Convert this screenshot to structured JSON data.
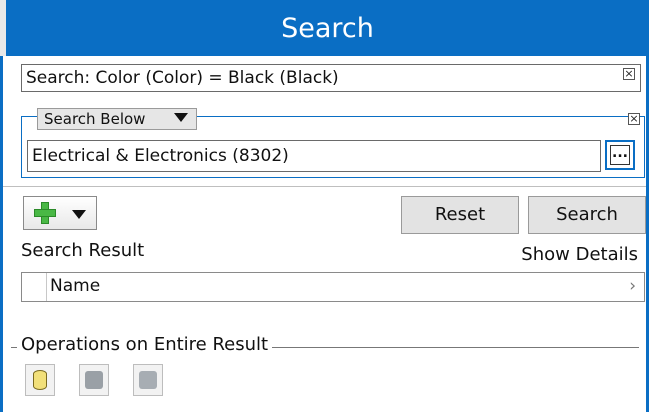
{
  "header": {
    "title": "Search"
  },
  "criteria": {
    "text": "Search: Color (Color) = Black (Black)",
    "close_glyph": "×"
  },
  "scope": {
    "dropdown_label": "Search Below",
    "close_glyph": "×",
    "value": "Electrical & Electronics (8302)",
    "browse_glyph": "..."
  },
  "toolbar": {
    "add_icon": "plus-icon",
    "reset_label": "Reset",
    "search_label": "Search"
  },
  "results": {
    "title": "Search Result",
    "details_link": "Show Details",
    "columns": [
      "Name"
    ],
    "column_arrow": "›"
  },
  "operations": {
    "title": "Operations on Entire Result",
    "icons": [
      "database-icon",
      "grey-db-icon",
      "grey-sheet-icon"
    ]
  },
  "colors": {
    "accent": "#0a6ec4",
    "button_bg": "#e3e3e3"
  }
}
